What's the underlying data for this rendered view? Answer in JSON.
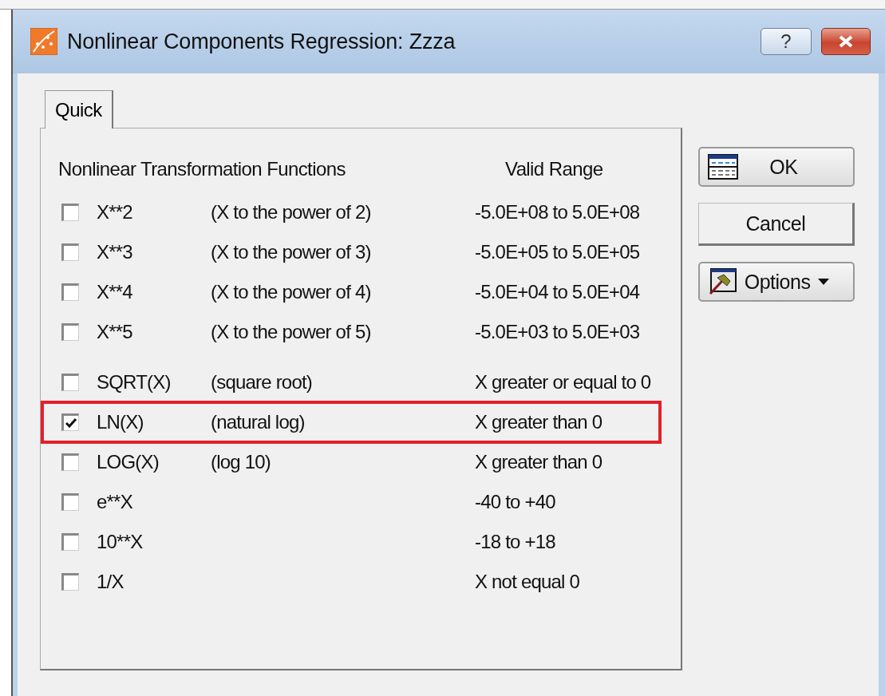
{
  "window": {
    "title": "Nonlinear Components Regression: Zzza",
    "help_button": "?"
  },
  "tabs": [
    {
      "label": "Quick",
      "selected": true
    }
  ],
  "headers": {
    "functions": "Nonlinear Transformation Functions",
    "range": "Valid Range"
  },
  "function_groups": [
    [
      {
        "name": "X**2",
        "description": "(X to the power of 2)",
        "range": "-5.0E+08 to 5.0E+08",
        "checked": false,
        "highlighted": false
      },
      {
        "name": "X**3",
        "description": "(X to the power of 3)",
        "range": "-5.0E+05 to 5.0E+05",
        "checked": false,
        "highlighted": false
      },
      {
        "name": "X**4",
        "description": "(X to the power of 4)",
        "range": "-5.0E+04 to 5.0E+04",
        "checked": false,
        "highlighted": false
      },
      {
        "name": "X**5",
        "description": "(X to the power of 5)",
        "range": "-5.0E+03 to 5.0E+03",
        "checked": false,
        "highlighted": false
      }
    ],
    [
      {
        "name": "SQRT(X)",
        "description": "(square root)",
        "range": "X greater or equal to 0",
        "checked": false,
        "highlighted": false
      },
      {
        "name": "LN(X)",
        "description": "(natural log)",
        "range": "X greater than 0",
        "checked": true,
        "highlighted": true
      },
      {
        "name": "LOG(X)",
        "description": "(log 10)",
        "range": "X greater than 0",
        "checked": false,
        "highlighted": false
      },
      {
        "name": "e**X",
        "range": "-40 to +40",
        "checked": false,
        "highlighted": false
      },
      {
        "name": "10**X",
        "range": "-18 to +18",
        "checked": false,
        "highlighted": false
      },
      {
        "name": "1/X",
        "range": "X not equal 0",
        "checked": false,
        "highlighted": false
      }
    ]
  ],
  "buttons": [
    {
      "label": "OK",
      "kind": "ok"
    },
    {
      "label": "Cancel",
      "kind": "plain"
    },
    {
      "label": "Options",
      "kind": "menu"
    }
  ]
}
